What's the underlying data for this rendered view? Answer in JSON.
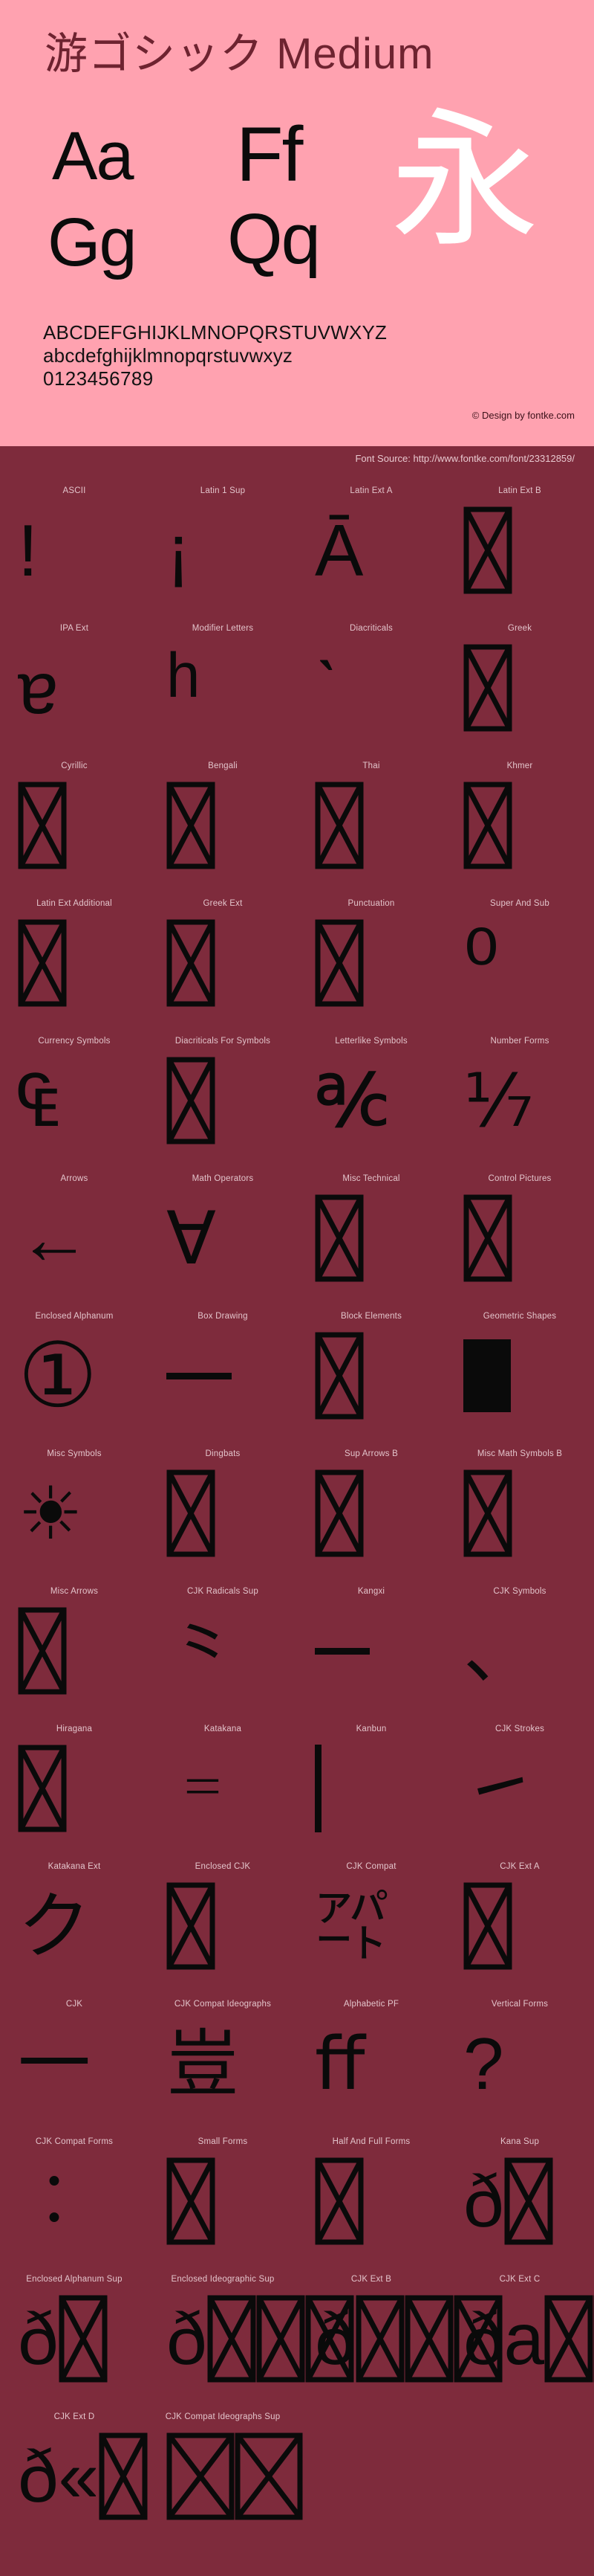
{
  "header": {
    "font_title": "游ゴシック Medium",
    "specimen": {
      "aa": "Aa",
      "gg": "Gg",
      "ff": "Ff",
      "qq": "Qq",
      "cjk": "永"
    },
    "alphabet_uppercase": "ABCDEFGHIJKLMNOPQRSTUVWXYZ",
    "alphabet_lowercase": "abcdefghijklmnopqrstuvwxyz",
    "digits": "0123456789",
    "credit": "© Design by fontke.com",
    "background_color": "#ffa2b0",
    "title_color": "#6e2330",
    "cjk_color": "#ffffff"
  },
  "source_bar": {
    "text": "Font Source: http://www.fontke.com/font/23312859/",
    "background_color": "#7e2b3c",
    "text_color": "#e8c8cf"
  },
  "grid": {
    "background_color": "#7e2b3c",
    "label_color": "#e3c4cb",
    "glyph_color": "#0a0a0a",
    "rows": [
      [
        {
          "label": "ASCII",
          "glyph": "!",
          "kind": "text",
          "size": "big"
        },
        {
          "label": "Latin 1 Sup",
          "glyph": "¡",
          "kind": "text",
          "size": "big"
        },
        {
          "label": "Latin Ext A",
          "glyph": "Ā",
          "kind": "text",
          "size": "big"
        },
        {
          "label": "Latin Ext B",
          "glyph": "",
          "kind": "notdef"
        }
      ],
      [
        {
          "label": "IPA Ext",
          "glyph": "ɐ",
          "kind": "text",
          "size": "big"
        },
        {
          "label": "Modifier Letters",
          "glyph": "ʰ",
          "kind": "text",
          "size": "huge"
        },
        {
          "label": "Diacriticals",
          "glyph": "ˋ",
          "kind": "text",
          "size": "big"
        },
        {
          "label": "Greek",
          "glyph": "",
          "kind": "notdef"
        }
      ],
      [
        {
          "label": "Cyrillic",
          "glyph": "",
          "kind": "notdef"
        },
        {
          "label": "Bengali",
          "glyph": "",
          "kind": "notdef"
        },
        {
          "label": "Thai",
          "glyph": "",
          "kind": "notdef"
        },
        {
          "label": "Khmer",
          "glyph": "",
          "kind": "notdef"
        }
      ],
      [
        {
          "label": "Latin Ext Additional",
          "glyph": "",
          "kind": "notdef"
        },
        {
          "label": "Greek Ext",
          "glyph": "",
          "kind": "notdef"
        },
        {
          "label": "Punctuation",
          "glyph": "",
          "kind": "notdef"
        },
        {
          "label": "Super And Sub",
          "glyph": "⁰",
          "kind": "text",
          "size": "huge"
        }
      ],
      [
        {
          "label": "Currency Symbols",
          "glyph": "₠",
          "kind": "text",
          "size": "big"
        },
        {
          "label": "Diacriticals For Symbols",
          "glyph": "",
          "kind": "notdef"
        },
        {
          "label": "Letterlike Symbols",
          "glyph": "℀",
          "kind": "text",
          "size": "big"
        },
        {
          "label": "Number Forms",
          "glyph": "⅐",
          "kind": "text",
          "size": "big"
        }
      ],
      [
        {
          "label": "Arrows",
          "glyph": "←",
          "kind": "text",
          "size": "big"
        },
        {
          "label": "Math Operators",
          "glyph": "∀",
          "kind": "text",
          "size": "big"
        },
        {
          "label": "Misc Technical",
          "glyph": "",
          "kind": "notdef"
        },
        {
          "label": "Control Pictures",
          "glyph": "",
          "kind": "notdef"
        }
      ],
      [
        {
          "label": "Enclosed Alphanum",
          "glyph": "①",
          "kind": "text",
          "size": "huge"
        },
        {
          "label": "Box Drawing",
          "glyph": "",
          "kind": "hline"
        },
        {
          "label": "Block Elements",
          "glyph": "",
          "kind": "notdef"
        },
        {
          "label": "Geometric Shapes",
          "glyph": "",
          "kind": "filled"
        }
      ],
      [
        {
          "label": "Misc Symbols",
          "glyph": "☀",
          "kind": "text",
          "size": "big"
        },
        {
          "label": "Dingbats",
          "glyph": "",
          "kind": "notdef"
        },
        {
          "label": "Sup Arrows B",
          "glyph": "",
          "kind": "notdef"
        },
        {
          "label": "Misc Math Symbols B",
          "glyph": "",
          "kind": "notdef"
        }
      ],
      [
        {
          "label": "Misc Arrows",
          "glyph": "",
          "kind": "notdef"
        },
        {
          "label": "CJK Radicals Sup",
          "glyph": "⺀",
          "kind": "text",
          "size": "big"
        },
        {
          "label": "Kangxi",
          "glyph": "",
          "kind": "hline-short"
        },
        {
          "label": "CJK Symbols",
          "glyph": "、",
          "kind": "text",
          "size": "big"
        }
      ],
      [
        {
          "label": "Hiragana",
          "glyph": "",
          "kind": "notdef"
        },
        {
          "label": "Katakana",
          "glyph": "゠",
          "kind": "text",
          "size": "big"
        },
        {
          "label": "Kanbun",
          "glyph": "",
          "kind": "vline"
        },
        {
          "label": "CJK Strokes",
          "glyph": "㇀",
          "kind": "text",
          "size": "big"
        }
      ],
      [
        {
          "label": "Katakana Ext",
          "glyph": "ク",
          "kind": "text",
          "size": "big"
        },
        {
          "label": "Enclosed CJK",
          "glyph": "",
          "kind": "notdef"
        },
        {
          "label": "CJK Compat",
          "glyph": "㌀",
          "kind": "text",
          "size": "big"
        },
        {
          "label": "CJK Ext A",
          "glyph": "",
          "kind": "notdef"
        }
      ],
      [
        {
          "label": "CJK",
          "glyph": "一",
          "kind": "text",
          "size": "big"
        },
        {
          "label": "CJK Compat Ideographs",
          "glyph": "豈",
          "kind": "text",
          "size": "big"
        },
        {
          "label": "Alphabetic PF",
          "glyph": "ﬀ",
          "kind": "text",
          "size": "big"
        },
        {
          "label": "Vertical Forms",
          "glyph": "?",
          "kind": "text",
          "size": "big"
        }
      ],
      [
        {
          "label": "CJK Compat Forms",
          "glyph": "︰",
          "kind": "text",
          "size": "big"
        },
        {
          "label": "Small Forms",
          "glyph": "",
          "kind": "notdef"
        },
        {
          "label": "Half And Full Forms",
          "glyph": "",
          "kind": "notdef"
        },
        {
          "label": "Kana Sup",
          "glyph": "ð",
          "kind": "overflow-2"
        }
      ],
      [
        {
          "label": "Enclosed Alphanum Sup",
          "glyph": "ð",
          "kind": "overflow-2"
        },
        {
          "label": "Enclosed Ideographic Sup",
          "glyph": "ð",
          "kind": "overflow-4"
        },
        {
          "label": "CJK Ext B",
          "glyph": "ð",
          "kind": "overflow-4"
        },
        {
          "label": "CJK Ext C",
          "glyph": "ða",
          "kind": "overflow-4"
        }
      ],
      [
        {
          "label": "CJK Ext D",
          "glyph": "ð«",
          "kind": "overflow-1"
        },
        {
          "label": "CJK Compat Ideographs Sup",
          "glyph": "",
          "kind": "overflow-wide"
        },
        {
          "label": "",
          "glyph": "",
          "kind": "empty"
        },
        {
          "label": "",
          "glyph": "",
          "kind": "empty"
        }
      ]
    ]
  }
}
